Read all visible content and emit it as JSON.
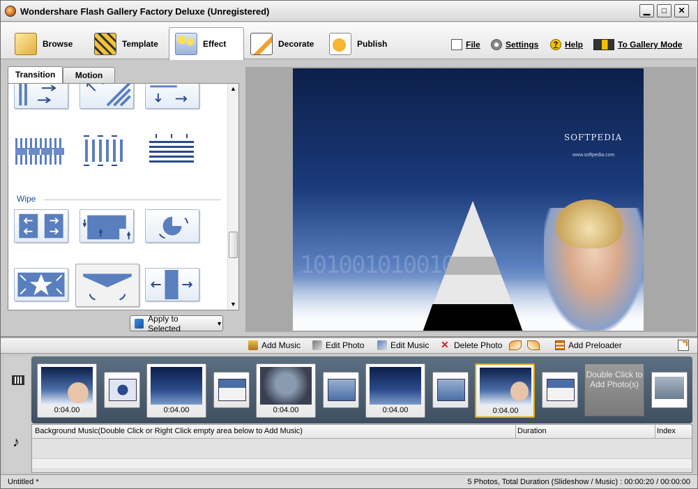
{
  "window": {
    "title": "Wondershare Flash Gallery Factory Deluxe (Unregistered)",
    "minimize": "▁",
    "maximize": "□",
    "close": "✕"
  },
  "toolbar": {
    "tabs": [
      {
        "label": "Browse",
        "icon": "browse-folder-icon"
      },
      {
        "label": "Template",
        "icon": "template-film-icon"
      },
      {
        "label": "Effect",
        "icon": "effect-stars-icon",
        "active": true
      },
      {
        "label": "Decorate",
        "icon": "decorate-pencil-icon"
      },
      {
        "label": "Publish",
        "icon": "publish-arrow-icon"
      }
    ],
    "links": [
      {
        "label": "File",
        "icon": "file-icon"
      },
      {
        "label": "Settings",
        "icon": "gear-icon"
      },
      {
        "label": "Help",
        "icon": "help-icon"
      },
      {
        "label": "To Gallery Mode",
        "icon": "gallery-mode-icon"
      }
    ]
  },
  "effects_panel": {
    "subtabs": [
      "Transition",
      "Motion"
    ],
    "active_subtab": "Transition",
    "section_wipe": "Wipe",
    "apply_label": "Apply to Selected",
    "apply_arrow": "▼"
  },
  "preview": {
    "brand": "SOFTPEDIA",
    "url": "www.softpedia.com",
    "binary": "10100101001011"
  },
  "actions": [
    {
      "label": "Add Music",
      "icon": "add-music-icon"
    },
    {
      "label": "Edit Photo",
      "icon": "edit-photo-icon"
    },
    {
      "label": "Edit Music",
      "icon": "edit-music-icon"
    },
    {
      "label": "Delete Photo",
      "icon": "delete-icon"
    },
    {
      "label": "",
      "icon": "rotate-left-icon"
    },
    {
      "label": "",
      "icon": "rotate-right-icon"
    },
    {
      "label": "Add Preloader",
      "icon": "preloader-icon"
    }
  ],
  "storyboard": {
    "durations": [
      "0:04.00",
      "0:04.00",
      "0:04.00",
      "0:04.00",
      "0:04.00"
    ],
    "add_photo_text": "Double Click to Add Photo(s)"
  },
  "music_table": {
    "col_music": "Background Music(Double Click or Right Click empty area below to Add Music)",
    "col_duration": "Duration",
    "col_index": "Index"
  },
  "status": {
    "left": "Untitled *",
    "right": "5 Photos, Total Duration (Slideshow / Music) : 00:00:20 / 00:00:00"
  },
  "colors": {
    "accent_blue": "#1a4fa3",
    "selection_gold": "#e0a800"
  }
}
